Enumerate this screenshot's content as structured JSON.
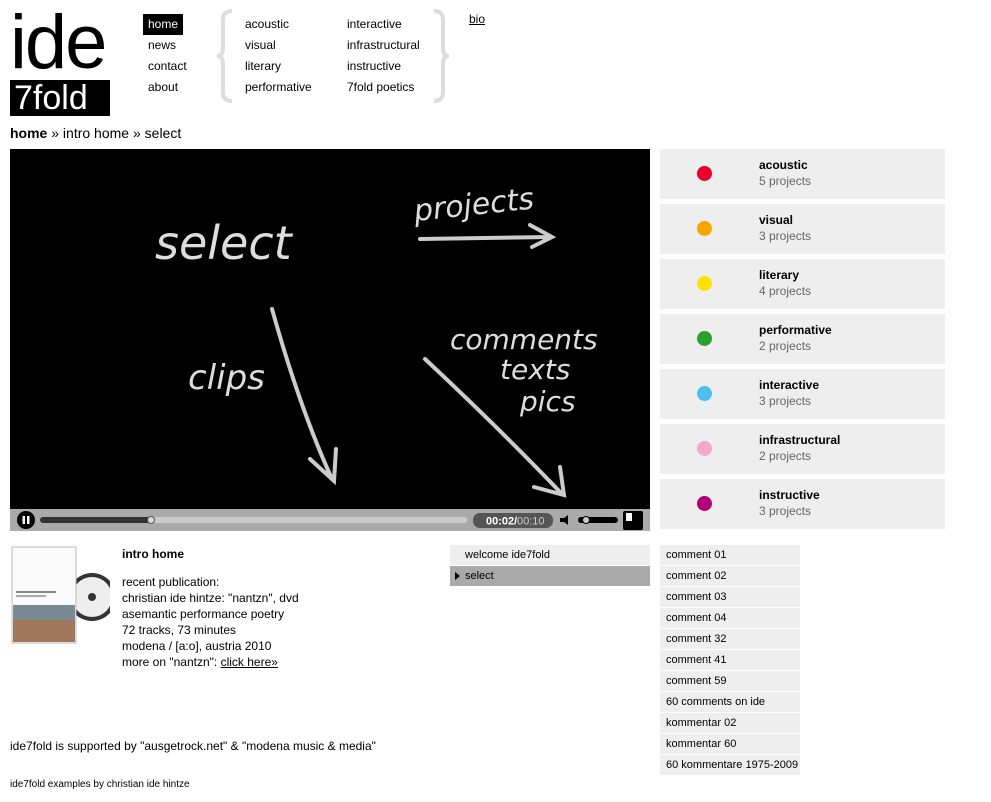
{
  "logo": {
    "top": "ide",
    "bottom": "7fold"
  },
  "nav_main": [
    {
      "label": "home",
      "active": true
    },
    {
      "label": "news"
    },
    {
      "label": "contact"
    },
    {
      "label": "about"
    }
  ],
  "nav_categories_col1": [
    "acoustic",
    "visual",
    "literary",
    "performative"
  ],
  "nav_categories_col2": [
    "interactive",
    "infrastructural",
    "instructive",
    "7fold poetics"
  ],
  "bio_link": "bio",
  "breadcrumb": {
    "home": "home",
    "sep": "»",
    "middle": "intro home",
    "current": "select"
  },
  "video": {
    "drawn_text": {
      "select": "select",
      "projects": "projects",
      "clips": "clips",
      "comments": "comments",
      "texts": "texts",
      "pics": "pics"
    },
    "time_current": "00:02/",
    "time_total": "00:10",
    "progress": 0.26,
    "volume": 0.2
  },
  "categories": [
    {
      "name": "acoustic",
      "count": "5 projects",
      "color": "#e8002a"
    },
    {
      "name": "visual",
      "count": "3 projects",
      "color": "#f7a600"
    },
    {
      "name": "literary",
      "count": "4 projects",
      "color": "#ffe000"
    },
    {
      "name": "performative",
      "count": "2 projects",
      "color": "#2ca02c"
    },
    {
      "name": "interactive",
      "count": "3 projects",
      "color": "#4cbfef"
    },
    {
      "name": "infrastructural",
      "count": "2 projects",
      "color": "#f4a7c6"
    },
    {
      "name": "instructive",
      "count": "3 projects",
      "color": "#b0007c"
    }
  ],
  "info": {
    "title": "intro home",
    "lines": [
      "recent publication:",
      "christian ide hintze: \"nantzn\", dvd",
      "asemantic performance poetry",
      "72 tracks, 73 minutes",
      "modena / [a:o], austria 2010"
    ],
    "more_prefix": "more on \"nantzn\": ",
    "more_link": "click here»"
  },
  "playlist": [
    {
      "label": "welcome ide7fold",
      "active": false
    },
    {
      "label": "select",
      "active": true
    }
  ],
  "comments": [
    "comment 01",
    "comment 02",
    "comment 03",
    "comment 04",
    "comment 32",
    "comment 41",
    "comment 59",
    "60 comments on ide",
    "kommentar 02",
    "kommentar 60",
    "60 kommentare 1975-2009"
  ],
  "supported": "ide7fold is supported by \"ausgetrock.net\" & \"modena music & media\"",
  "footer": "ide7fold examples by christian ide hintze"
}
